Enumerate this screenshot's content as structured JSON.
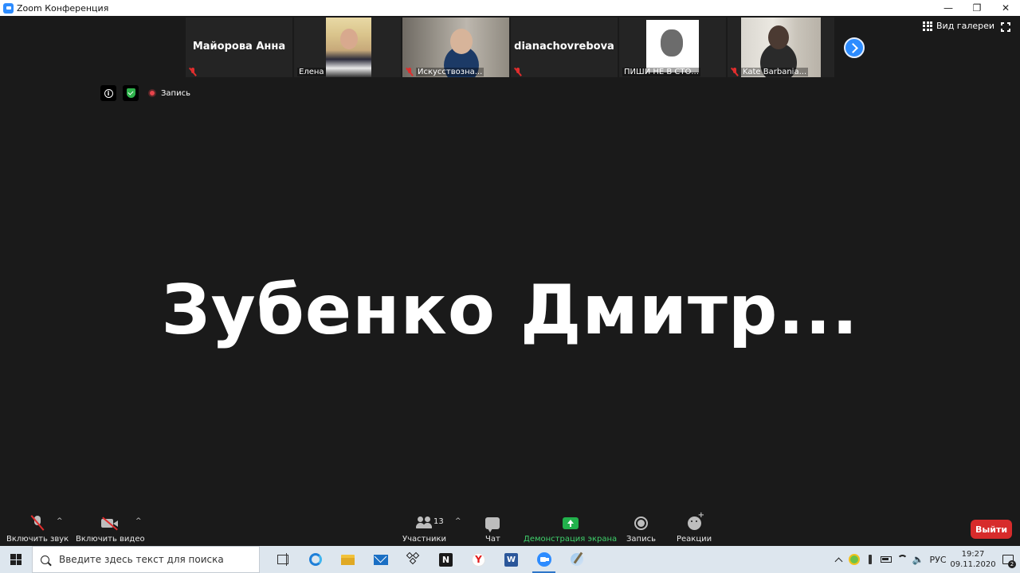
{
  "window": {
    "title": "Zoom Конференция",
    "controls": {
      "minimize": "—",
      "restore": "❐",
      "close": "✕"
    }
  },
  "thumbnails": [
    {
      "type": "name",
      "name": "Майорова Анна",
      "caption": ""
    },
    {
      "type": "video",
      "caption": "Елена",
      "photo": "elena"
    },
    {
      "type": "video",
      "caption": "Искусствозна...",
      "photo": "iskus"
    },
    {
      "type": "name",
      "name": "dianachovrebova",
      "caption": ""
    },
    {
      "type": "video",
      "caption": "ПИШИ НЕ В СТО...",
      "photo": "pishi"
    },
    {
      "type": "video",
      "caption": "Kate Barbania...",
      "photo": "kate"
    }
  ],
  "gallery": {
    "label": "Вид галереи"
  },
  "status": {
    "recording_label": "Запись",
    "info_icon": "i"
  },
  "speaker": {
    "name": "Зубенко  Дмитр..."
  },
  "toolbar": {
    "audio": "Включить звук",
    "video": "Включить видео",
    "participants": "Участники",
    "participants_count": "13",
    "chat": "Чат",
    "share": "Демонстрация экрана",
    "record": "Запись",
    "reactions": "Реакции",
    "leave": "Выйти",
    "caret": "^"
  },
  "taskbar": {
    "search_placeholder": "Введите здесь текст для поиска",
    "notion_letter": "N",
    "yandex_letter": "Y",
    "word_letter": "W",
    "language": "РУС",
    "time": "19:27",
    "date": "09.11.2020",
    "notifications_count": "2"
  },
  "colors": {
    "zoom_blue": "#2d8cff",
    "share_green": "#22b14c",
    "leave_red": "#d72b2b",
    "mute_red": "#e02d2d"
  }
}
